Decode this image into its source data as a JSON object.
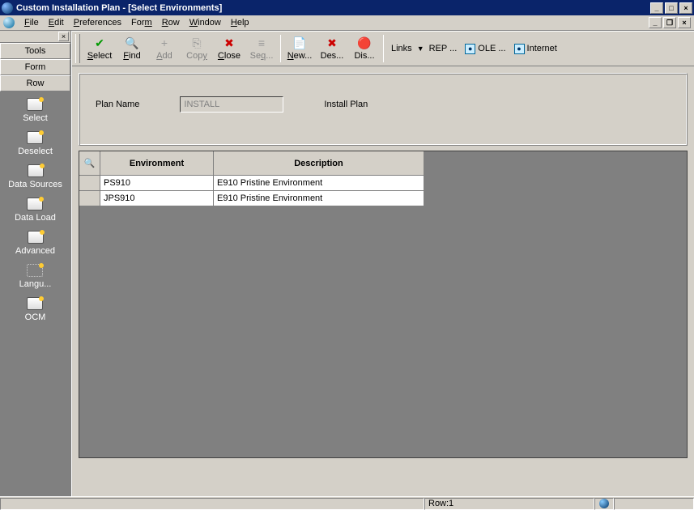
{
  "title": "Custom Installation Plan - [Select Environments]",
  "menus": {
    "file": "File",
    "edit": "Edit",
    "preferences": "Preferences",
    "form": "Form",
    "row": "Row",
    "window": "Window",
    "help": "Help"
  },
  "sidebar": {
    "tabs": {
      "tools": "Tools",
      "form": "Form",
      "row": "Row"
    },
    "actions": [
      "Select",
      "Deselect",
      "Data Sources",
      "Data Load",
      "Advanced",
      "Langu...",
      "OCM"
    ]
  },
  "toolbar": {
    "select": "Select",
    "find": "Find",
    "add": "Add",
    "copy": "Copy",
    "close": "Close",
    "seq": "Seq...",
    "new": "New...",
    "des": "Des...",
    "dis": "Dis...",
    "links": "Links",
    "rep": "REP ...",
    "ole": "OLE ...",
    "internet": "Internet"
  },
  "form": {
    "planNameLabel": "Plan Name",
    "planNameValue": "INSTALL",
    "installPlanLabel": "Install Plan"
  },
  "grid": {
    "headers": {
      "env": "Environment",
      "desc": "Description"
    },
    "rows": [
      {
        "env": "PS910",
        "desc": "E910 Pristine Environment"
      },
      {
        "env": "JPS910",
        "desc": "E910 Pristine Environment"
      }
    ]
  },
  "status": {
    "row": "Row:1"
  }
}
